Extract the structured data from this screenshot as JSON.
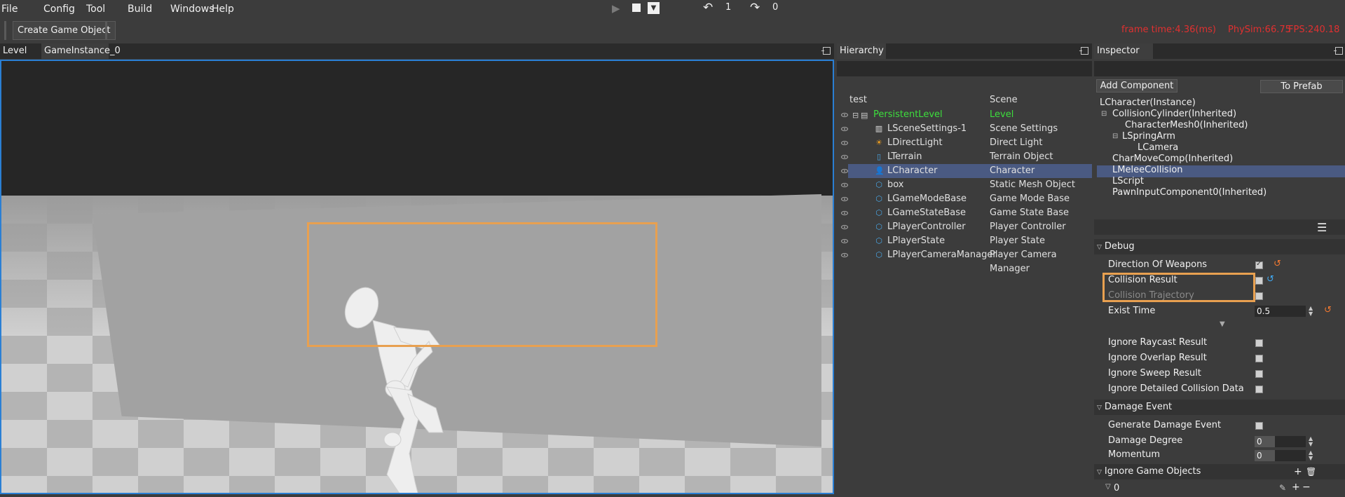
{
  "menu": {
    "file": "File",
    "config": "Config",
    "tool": "Tool",
    "build": "Build",
    "windows": "Windows",
    "help": "Help"
  },
  "toolbar": {
    "create_game_object": "Create Game Object",
    "undo_count": "1",
    "redo_count": "0"
  },
  "stats": {
    "frame_time": "frame time:4.36(ms)",
    "physsim": "PhySim:66.75",
    "fps": "FPS:240.18"
  },
  "viewport": {
    "tab_level": "Level",
    "tab_instance": "GameInstance_0"
  },
  "hierarchy": {
    "title": "Hierarchy",
    "col_name": "test",
    "col_type": "Scene",
    "rows": [
      {
        "name": "PersistentLevel",
        "type": "Level"
      },
      {
        "name": "LSceneSettings-1",
        "type": "Scene Settings"
      },
      {
        "name": "LDirectLight",
        "type": "Direct Light"
      },
      {
        "name": "LTerrain",
        "type": "Terrain Object"
      },
      {
        "name": "LCharacter",
        "type": "Character"
      },
      {
        "name": "box",
        "type": "Static Mesh Object"
      },
      {
        "name": "LGameModeBase",
        "type": "Game Mode Base"
      },
      {
        "name": "LGameStateBase",
        "type": "Game State Base"
      },
      {
        "name": "LPlayerController",
        "type": "Player Controller"
      },
      {
        "name": "LPlayerState",
        "type": "Player State"
      },
      {
        "name": "LPlayerCameraManager",
        "type": "Player Camera Manager"
      }
    ]
  },
  "inspector": {
    "title": "Inspector",
    "add_component": "Add Component",
    "to_prefab": "To Prefab",
    "components": [
      "LCharacter(Instance)",
      "CollisionCylinder(Inherited)",
      "CharacterMesh0(Inherited)",
      "LSpringArm",
      "LCamera",
      "CharMoveComp(Inherited)",
      "LMeleeCollision",
      "LScript",
      "PawnInputComponent0(Inherited)"
    ],
    "debug": {
      "title": "Debug",
      "direction_of_weapons": "Direction Of Weapons",
      "collision_result": "Collision Result",
      "collision_trajectory": "Collision Trajectory",
      "exist_time": "Exist Time",
      "exist_time_value": "0.5",
      "ignore_raycast": "Ignore Raycast Result",
      "ignore_overlap": "Ignore Overlap Result",
      "ignore_sweep": "Ignore Sweep Result",
      "ignore_detailed": "Ignore Detailed Collision Data"
    },
    "damage": {
      "title": "Damage Event",
      "generate": "Generate Damage Event",
      "degree": "Damage Degree",
      "degree_value": "0",
      "momentum": "Momentum",
      "momentum_value": "0"
    },
    "ignore_objects": {
      "title": "Ignore Game Objects",
      "index": "0"
    }
  },
  "colors": {
    "accent_blue": "#2a7fd4",
    "highlight": "#e8a050",
    "root_green": "#3dde3d",
    "stat_red": "#e03030",
    "selection": "#4a5a82"
  }
}
